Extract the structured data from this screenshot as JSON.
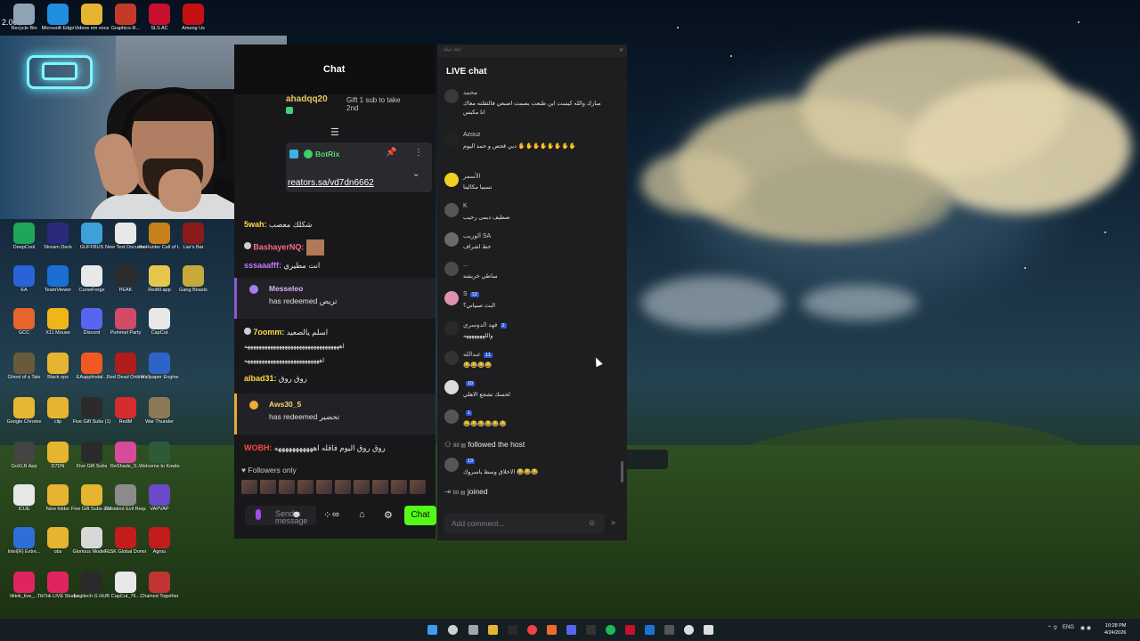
{
  "desktop": {
    "overlay_text": "2.00$",
    "icons": [
      {
        "label": "Recycle Bin",
        "color": "#8fa3b5"
      },
      {
        "label": "Microsoft Edge",
        "color": "#1f8fe0"
      },
      {
        "label": "Videos em voce",
        "color": "#e6b430"
      },
      {
        "label": "Graphics-R...",
        "color": "#c43a2a"
      },
      {
        "label": "SLS AC",
        "color": "#c8102e"
      },
      {
        "label": "Among Us",
        "color": "#c51111"
      },
      {
        "label": "DeepCool",
        "color": "#1fa65a"
      },
      {
        "label": "Stream Deck",
        "color": "#2a2a7a"
      },
      {
        "label": "GUFFBUS",
        "color": "#3ea0d9"
      },
      {
        "label": "New Text Document",
        "color": "#e8e8e8"
      },
      {
        "label": "theHunter Call of t...",
        "color": "#c7811c"
      },
      {
        "label": "Liar's Bar",
        "color": "#8a1b1b"
      },
      {
        "label": "EA",
        "color": "#2a62d8"
      },
      {
        "label": "TeamViewer",
        "color": "#1a6fd4"
      },
      {
        "label": "CurseForge",
        "color": "#e8e8e8"
      },
      {
        "label": "PEAK",
        "color": "#2c2c2c"
      },
      {
        "label": "RedM.app",
        "color": "#e6c64a"
      },
      {
        "label": "Gang Beasts",
        "color": "#c6a83b"
      },
      {
        "label": "GCC",
        "color": "#e6652a"
      },
      {
        "label": "X11 Mouse",
        "color": "#f0b51a"
      },
      {
        "label": "Discord",
        "color": "#5865f2"
      },
      {
        "label": "Pummel Party",
        "color": "#d14a68"
      },
      {
        "label": "CapCut",
        "color": "#e8e8e8"
      },
      {
        "label": "Ghost of a Tale",
        "color": "#6a5a3c"
      },
      {
        "label": "Black ops",
        "color": "#e6b430"
      },
      {
        "label": "EAappInstal...",
        "color": "#f05a22"
      },
      {
        "label": "Red Dead Online",
        "color": "#b01c1c"
      },
      {
        "label": "Wallpaper Engine",
        "color": "#2e64c8"
      },
      {
        "label": "Google Chrome",
        "color": "#e7b733"
      },
      {
        "label": "clip",
        "color": "#e6b430"
      },
      {
        "label": "Five Gift Subs (1)",
        "color": "#2b2b2b"
      },
      {
        "label": "RedM",
        "color": "#d62c2c"
      },
      {
        "label": "War Thunder",
        "color": "#8a7a58"
      },
      {
        "label": "GoXLR App",
        "color": "#444444"
      },
      {
        "label": "D7DN",
        "color": "#e6b430"
      },
      {
        "label": "Five Gift Subs",
        "color": "#2b2b2b"
      },
      {
        "label": "ReShade_S...",
        "color": "#d84a9a"
      },
      {
        "label": "Welcome to Kowloon",
        "color": "#2e5a3a"
      },
      {
        "label": "iCUE",
        "color": "#e8e8e8"
      },
      {
        "label": "New folder",
        "color": "#e6b430"
      },
      {
        "label": "Five Gift Subs-2025...",
        "color": "#e6b430"
      },
      {
        "label": "Resident Evil Requiem",
        "color": "#8b8b8b"
      },
      {
        "label": "VAPVAP",
        "color": "#6a4ac8"
      },
      {
        "label": "Intel(R) Extre...",
        "color": "#2d6fd6"
      },
      {
        "label": "obs",
        "color": "#e6b430"
      },
      {
        "label": "Glorious Model ...",
        "color": "#d8d8d8"
      },
      {
        "label": "RISK Global Domination",
        "color": "#c31c1c"
      },
      {
        "label": "Agrou",
        "color": "#c31c1c"
      },
      {
        "label": "tiktok_live_...",
        "color": "#e0245e"
      },
      {
        "label": "TikTok LIVE Studio",
        "color": "#e0245e"
      },
      {
        "label": "Logitech G HUB",
        "color": "#2a2a2a"
      },
      {
        "label": "CapCut_76...",
        "color": "#e8e8e8"
      },
      {
        "label": "Chained Together",
        "color": "#c03434"
      }
    ]
  },
  "chat_panel": {
    "title": "Chat",
    "gift_user": "ahadqq20",
    "gift_text": "Gift 1 sub to take 2nd",
    "pinned_name": "BotRix",
    "pinned_link": "reators.sa/vd7dn6662",
    "messages": [
      {
        "user": "5wah:",
        "text": "شكلك معصب",
        "color": "#ffd84a"
      },
      {
        "user": "BashayerNQ:",
        "text": "",
        "color": "#ff6a8a"
      },
      {
        "user": "sssaaafff:",
        "text": "انت مطيري",
        "color": "#c27bff"
      },
      {
        "user": "7oomm:",
        "text": "اسلم يالصعيد",
        "color": "#ffd84a"
      },
      {
        "user": "",
        "text": "اهههههههههههههههههههههههههههههههههه",
        "color": "#e8e8e8"
      },
      {
        "user": "",
        "text": "اههههههههههههههههههههههههههه",
        "color": "#e8e8e8"
      },
      {
        "user": "albad31:",
        "text": "روق روق",
        "color": "#ffd84a"
      },
      {
        "user": "WOBH:",
        "text": "روق روق اليوم فاقله اهههههههههههه",
        "color": "#ff4a3a"
      }
    ],
    "redeem1_user": "Messeleo",
    "redeem1_text": "has redeemed تريص",
    "redeem2_user": "Aws30_5",
    "redeem2_text": "has redeemed تحضير",
    "followers_label": "Followers only",
    "input_placeholder": "Send a message",
    "chat_button": "Chat"
  },
  "live_chat": {
    "header_small": "ايلك ابيلك",
    "title": "LIVE chat",
    "messages": [
      {
        "name": "محمد",
        "badge": "",
        "text": "مبارك والله كيست اين طبعت بصمت اصبعي فالثقلته معاك",
        "text2": "انا مكيس",
        "avatar": "#3a3a3a"
      },
      {
        "name": "Azouz",
        "badge": "",
        "text": "دبي قحص و حمد اليوم",
        "text2": "",
        "avatar": "#222222"
      },
      {
        "name": "الأسمر",
        "badge": "",
        "text": "نسيبا مكاليتا",
        "text2": "",
        "avatar": "#f0d020"
      },
      {
        "name": "K",
        "badge": "",
        "text": "صطيف دبمى رحيب",
        "text2": "",
        "avatar": "#555555"
      },
      {
        "name": "الوريب SA",
        "badge": "",
        "text": "خط اشراف",
        "text2": "",
        "avatar": "#6a6a6a"
      },
      {
        "name": "...",
        "badge": "",
        "text": "ساطي خربشه",
        "text2": "",
        "avatar": "#4a4a4a"
      },
      {
        "name": "S",
        "badge": "12",
        "text": "البث صبياني؟",
        "text2": "",
        "avatar": "#e090b0"
      },
      {
        "name": "فهد الدوسري",
        "badge": "2",
        "text": "واللهههههههه",
        "text2": "",
        "avatar": "#2a2a2a"
      },
      {
        "name": "عبدالله",
        "badge": "11",
        "text": "",
        "text2": "",
        "avatar": "#333333"
      },
      {
        "name": "",
        "badge": "10",
        "text": "لحسك تشجع الاهلي",
        "text2": "",
        "avatar": "#dcdcdc"
      },
      {
        "name": "",
        "badge": "1",
        "text": "",
        "text2": "",
        "avatar": "#555555"
      }
    ],
    "followed_text": "followed the host",
    "last_msg_text": "الاخلاق وسط ياسروك",
    "last_badge": "13",
    "joined_text": "joined",
    "comment_placeholder": "Add comment..."
  },
  "taskbar": {
    "tray_lang": "ENG",
    "time": "10:28 PM",
    "date": "4/24/2026"
  }
}
